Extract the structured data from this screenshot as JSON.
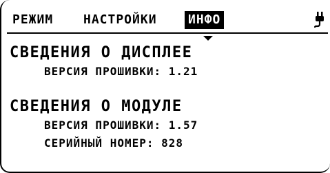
{
  "tabs": [
    {
      "label": "РЕЖИМ",
      "active": false
    },
    {
      "label": "НАСТРОЙКИ",
      "active": false
    },
    {
      "label": "ИНФО",
      "active": true
    }
  ],
  "status_icon": "plug-icon",
  "display_info": {
    "title": "СВЕДЕНИЯ О ДИСПЛЕЕ",
    "firmware_label": "ВЕРСИЯ ПРОШИВКИ:",
    "firmware_value": "1.21"
  },
  "module_info": {
    "title": "СВЕДЕНИЯ О МОДУЛЕ",
    "firmware_label": "ВЕРСИЯ ПРОШИВКИ:",
    "firmware_value": "1.57",
    "serial_label": "СЕРИЙНЫЙ НОМЕР:",
    "serial_value": "828"
  },
  "colors": {
    "background": "#ffffff",
    "foreground": "#000000"
  }
}
